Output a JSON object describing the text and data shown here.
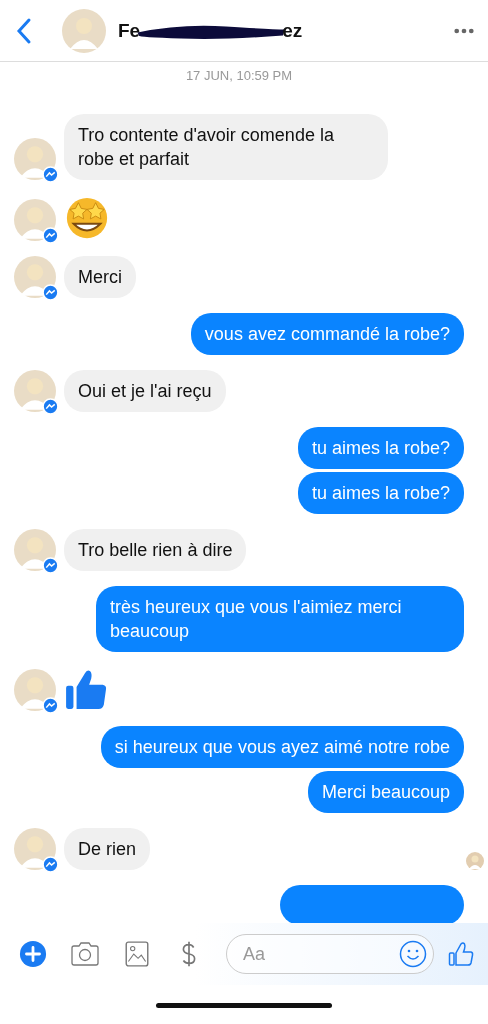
{
  "header": {
    "name_start": "Fe",
    "name_end": "ez",
    "redacted": true
  },
  "timestamp": "17 JUN, 10:59 PM",
  "messages": [
    {
      "outgoing": false,
      "kind": "text",
      "text": "Tro contente d'avoir comende  la robe et parfait"
    },
    {
      "outgoing": false,
      "kind": "emoji"
    },
    {
      "outgoing": false,
      "kind": "text",
      "text": "Merci"
    },
    {
      "outgoing": true,
      "kind": "text",
      "text": "vous avez commandé la robe?"
    },
    {
      "outgoing": false,
      "kind": "text",
      "text": "Oui et je l'ai reçu"
    },
    {
      "outgoing": true,
      "kind": "text",
      "text": "tu aimes la robe?"
    },
    {
      "outgoing": true,
      "kind": "text",
      "text": "tu aimes la robe?"
    },
    {
      "outgoing": false,
      "kind": "text",
      "text": "Tro belle rien à dire"
    },
    {
      "outgoing": true,
      "kind": "text",
      "text": "très heureux que vous l'aimiez merci beaucoup"
    },
    {
      "outgoing": false,
      "kind": "like"
    },
    {
      "outgoing": true,
      "kind": "text",
      "text": "si heureux que vous ayez aimé notre robe"
    },
    {
      "outgoing": true,
      "kind": "text",
      "text": "Merci beaucoup"
    },
    {
      "outgoing": false,
      "kind": "text",
      "text": "De rien",
      "seen": true
    },
    {
      "outgoing": true,
      "kind": "partial"
    }
  ],
  "composer": {
    "placeholder": "Aa"
  }
}
